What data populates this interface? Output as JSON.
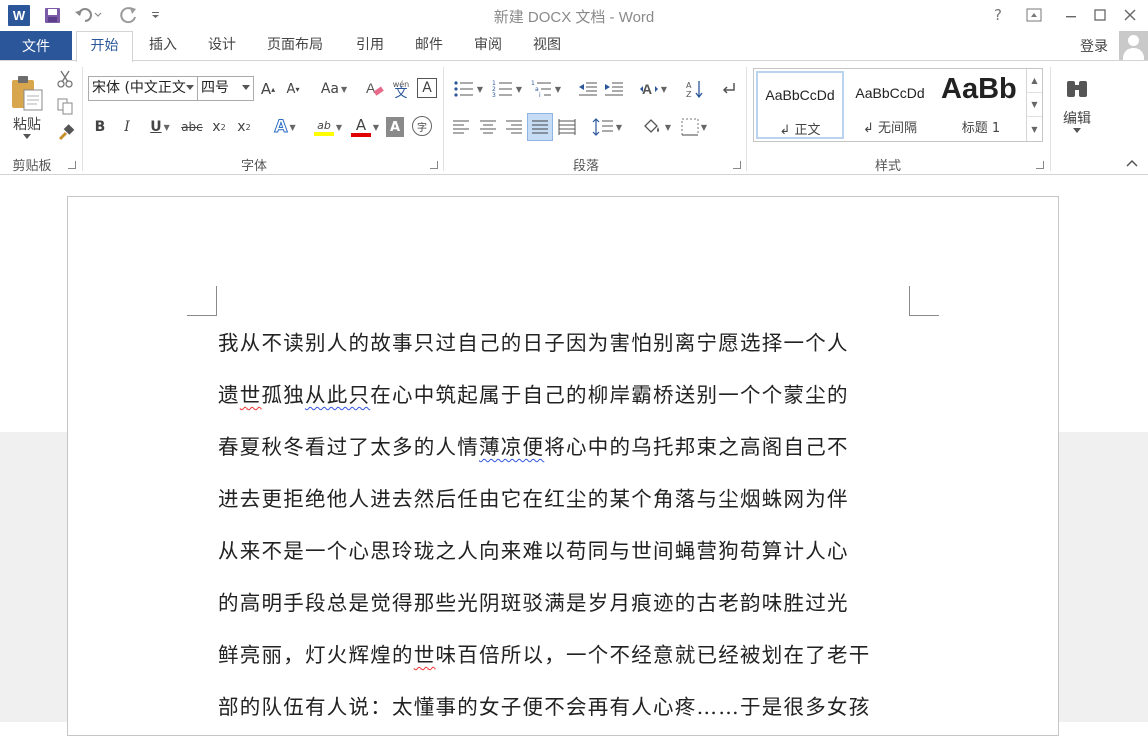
{
  "window": {
    "title": "新建 DOCX 文档 - Word"
  },
  "quick_access": {
    "logo_letter": "W"
  },
  "window_controls": {
    "help": "?",
    "ribbon_display": "▣",
    "minimize": "—",
    "restore": "☐",
    "close": "✕"
  },
  "tabs": {
    "file": "文件",
    "items": [
      "开始",
      "插入",
      "设计",
      "页面布局",
      "引用",
      "邮件",
      "审阅",
      "视图"
    ]
  },
  "account": {
    "login": "登录"
  },
  "ribbon": {
    "clipboard": {
      "label": "剪贴板",
      "paste": "粘贴"
    },
    "font": {
      "label": "字体",
      "font_name": "宋体 (中文正文",
      "font_size": "四号",
      "grow": "A",
      "shrink": "A",
      "case": "Aa",
      "phonetic": "wén",
      "phonetic_char": "文",
      "border_char": "A",
      "bold": "B",
      "italic": "I",
      "underline": "U",
      "strike": "abc",
      "sub": "x",
      "sup": "x",
      "effects": "A",
      "highlight": "ab",
      "color": "A",
      "shading": "A",
      "enclose": "字"
    },
    "paragraph": {
      "label": "段落"
    },
    "styles": {
      "label": "样式",
      "items": [
        {
          "sample": "AaBbCcDd",
          "name": "↲ 正文"
        },
        {
          "sample": "AaBbCcDd",
          "name": "↲ 无间隔"
        },
        {
          "sample": "AaBb",
          "name": "标题 1"
        }
      ]
    },
    "editing": {
      "label": "编辑"
    }
  },
  "document": {
    "lines": [
      [
        {
          "t": "我从不读别人的故事只过自己的日子因为害怕别离宁愿选择一个人"
        }
      ],
      [
        {
          "t": "遗"
        },
        {
          "t": "世",
          "sq": "red"
        },
        {
          "t": "孤独"
        },
        {
          "t": "从此只",
          "sq": "blue"
        },
        {
          "t": "在心中筑起属于自己的柳岸霸桥送别一个个蒙尘的"
        }
      ],
      [
        {
          "t": "春夏秋冬看过了太多的人情"
        },
        {
          "t": "薄凉便",
          "sq": "blue"
        },
        {
          "t": "将心中的乌托邦束之高阁自己不"
        }
      ],
      [
        {
          "t": "进去更拒绝他人进去然后任由它在红尘的某个角落与尘烟蛛网为伴"
        }
      ],
      [
        {
          "t": "从来不是一个心思玲珑之人向来难以苟同与世间蝇营狗苟算计人心"
        }
      ],
      [
        {
          "t": "的高明手段总是觉得那些光阴斑驳满是岁月痕迹的古老韵味胜过光"
        }
      ],
      [
        {
          "t": "鲜亮丽，灯火辉煌的"
        },
        {
          "t": "世",
          "sq": "red"
        },
        {
          "t": "味百倍所以，一个不经意就已经被划在了老干"
        }
      ],
      [
        {
          "t": "部的队伍有人说：太懂事的女子便不会再有人心疼……于是很多女孩"
        }
      ]
    ]
  },
  "colors": {
    "accent": "#2b579a",
    "squiggle_red": "#e33333",
    "squiggle_blue": "#3355dd",
    "font_red": "#e00000",
    "highlight_yellow": "#ffff00"
  }
}
